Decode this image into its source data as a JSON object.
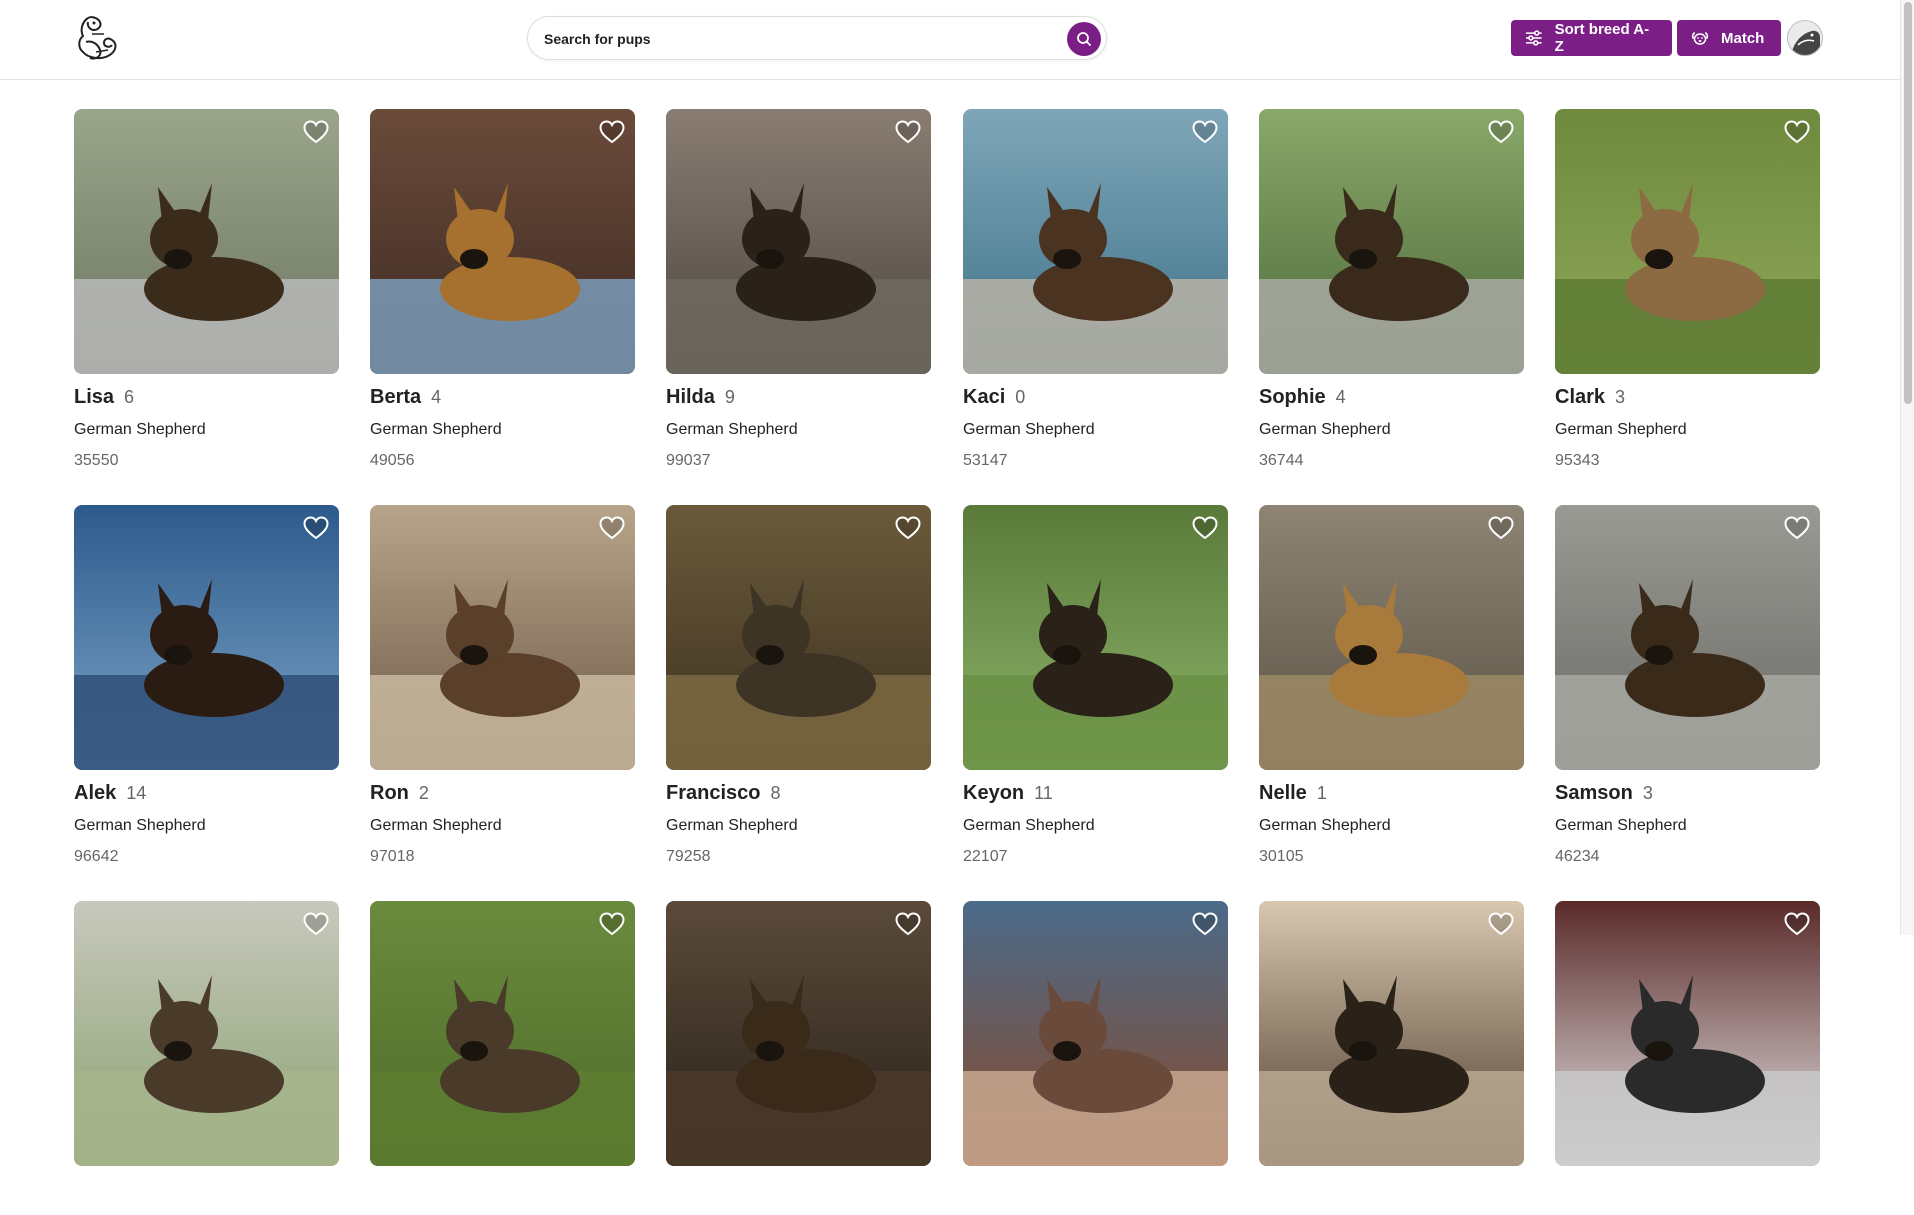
{
  "header": {
    "logo_icon": "dog-sketch-logo",
    "search": {
      "placeholder": "Search for pups",
      "icon": "search-icon"
    },
    "sort_button": {
      "label": "Sort breed A-Z",
      "icon": "sliders-icon"
    },
    "match_button": {
      "label": "Match",
      "icon": "dog-face-icon"
    },
    "accent_color": "#7b1f86"
  },
  "dogs": [
    {
      "name": "Lisa",
      "age": "6",
      "breed": "German Shepherd",
      "zip": "35550"
    },
    {
      "name": "Berta",
      "age": "4",
      "breed": "German Shepherd",
      "zip": "49056"
    },
    {
      "name": "Hilda",
      "age": "9",
      "breed": "German Shepherd",
      "zip": "99037"
    },
    {
      "name": "Kaci",
      "age": "0",
      "breed": "German Shepherd",
      "zip": "53147"
    },
    {
      "name": "Sophie",
      "age": "4",
      "breed": "German Shepherd",
      "zip": "36744"
    },
    {
      "name": "Clark",
      "age": "3",
      "breed": "German Shepherd",
      "zip": "95343"
    },
    {
      "name": "Alek",
      "age": "14",
      "breed": "German Shepherd",
      "zip": "96642"
    },
    {
      "name": "Ron",
      "age": "2",
      "breed": "German Shepherd",
      "zip": "97018"
    },
    {
      "name": "Francisco",
      "age": "8",
      "breed": "German Shepherd",
      "zip": "79258"
    },
    {
      "name": "Keyon",
      "age": "11",
      "breed": "German Shepherd",
      "zip": "22107"
    },
    {
      "name": "Nelle",
      "age": "1",
      "breed": "German Shepherd",
      "zip": "30105"
    },
    {
      "name": "Samson",
      "age": "3",
      "breed": "German Shepherd",
      "zip": "46234"
    },
    {
      "name": "",
      "age": "",
      "breed": "",
      "zip": ""
    },
    {
      "name": "",
      "age": "",
      "breed": "",
      "zip": ""
    },
    {
      "name": "",
      "age": "",
      "breed": "",
      "zip": ""
    },
    {
      "name": "",
      "age": "",
      "breed": "",
      "zip": ""
    },
    {
      "name": "",
      "age": "",
      "breed": "",
      "zip": ""
    },
    {
      "name": "",
      "age": "",
      "breed": "",
      "zip": ""
    }
  ]
}
